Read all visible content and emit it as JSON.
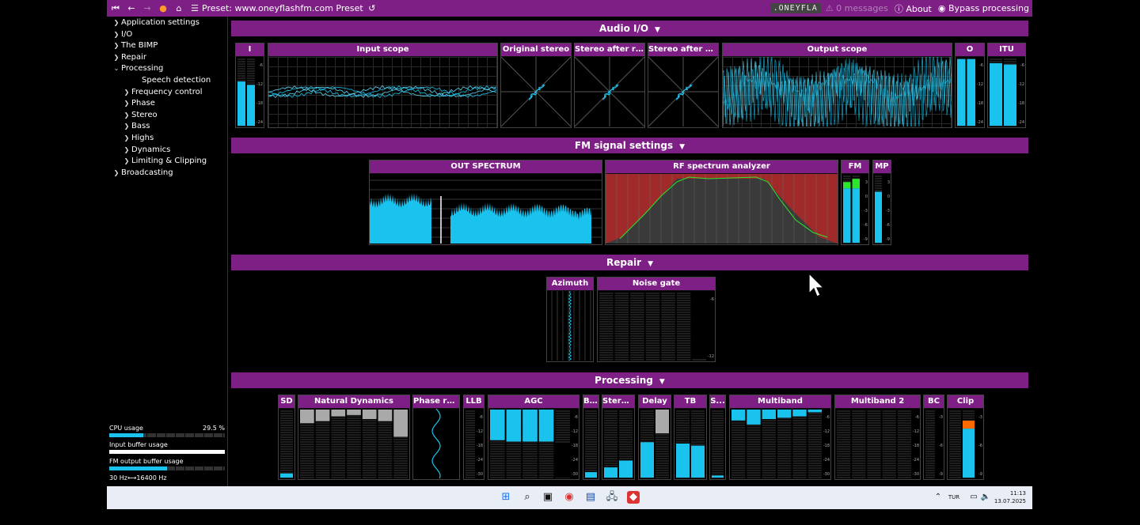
{
  "topbar": {
    "preset_label": "Preset: www.oneyflashfm.com Preset",
    "brand": ".ONEYFLA",
    "messages": "0 messages",
    "about": "About",
    "bypass": "Bypass processing"
  },
  "sidebar": {
    "items": [
      {
        "label": "Application settings",
        "indent": 0,
        "chevron": "right"
      },
      {
        "label": "I/O",
        "indent": 0,
        "chevron": "right"
      },
      {
        "label": "The BIMP",
        "indent": 0,
        "chevron": "right"
      },
      {
        "label": "Repair",
        "indent": 0,
        "chevron": "right"
      },
      {
        "label": "Processing",
        "indent": 0,
        "chevron": "down"
      },
      {
        "label": "Speech detection",
        "indent": 2,
        "chevron": "none"
      },
      {
        "label": "Frequency control",
        "indent": 1,
        "chevron": "right"
      },
      {
        "label": "Phase",
        "indent": 1,
        "chevron": "right"
      },
      {
        "label": "Stereo",
        "indent": 1,
        "chevron": "right"
      },
      {
        "label": "Bass",
        "indent": 1,
        "chevron": "right"
      },
      {
        "label": "Highs",
        "indent": 1,
        "chevron": "right"
      },
      {
        "label": "Dynamics",
        "indent": 1,
        "chevron": "right"
      },
      {
        "label": "Limiting & Clipping",
        "indent": 1,
        "chevron": "right"
      },
      {
        "label": "Broadcasting",
        "indent": 0,
        "chevron": "right"
      }
    ],
    "cpu_label": "CPU usage",
    "cpu_value": "29.5 %",
    "cpu_fraction": 0.295,
    "input_buffer_label": "Input buffer usage",
    "input_buffer_fraction": 1.0,
    "fm_buffer_label": "FM output buffer usage",
    "fm_buffer_fraction": 0.5,
    "freq_low": "30 Hz",
    "freq_high": "16400 Hz"
  },
  "sections": {
    "audio_io": "Audio I/O",
    "fm_signal": "FM signal settings",
    "repair": "Repair",
    "processing": "Processing"
  },
  "panels": {
    "input_meter": "I",
    "input_scope": "Input scope",
    "original_stereo": "Original stereo",
    "stereo_after_rep": "Stereo after rep...",
    "stereo_after_pro": "Stereo after pro...",
    "output_scope": "Output scope",
    "output_meter": "O",
    "itu": "ITU",
    "out_spectrum": "OUT SPECTRUM",
    "rf_analyzer": "RF spectrum analyzer",
    "fm": "FM",
    "mp": "MP",
    "azimuth": "Azimuth",
    "noise_gate": "Noise gate",
    "sd": "SD",
    "natural_dynamics": "Natural Dynamics",
    "phase_rot": "Phase rot...",
    "llb": "LLB",
    "agc": "AGC",
    "b": "B...",
    "stereo": "Stere...",
    "delay": "Delay",
    "tb": "TB",
    "s": "S...",
    "multiband": "Multiband",
    "multiband2": "Multiband 2",
    "bc": "BC",
    "clip": "Clip"
  },
  "meter_ticks": {
    "io": [
      "-6",
      "-12",
      "-18",
      "-24"
    ],
    "fm": [
      "3",
      "0",
      "-3",
      "-6",
      "-9"
    ],
    "ng": [
      "-6",
      "-12"
    ],
    "agc": [
      "-6",
      "-12",
      "-18",
      "-24",
      "-30"
    ],
    "bc": [
      "-3",
      "-6",
      "-9"
    ]
  },
  "colors": {
    "accent": "#7e1f86",
    "meter": "#19c3ee",
    "gray_bar": "#a9a9a9",
    "green": "#2ee62e",
    "orange": "#ff6a00",
    "rf_red": "#a02a2a"
  },
  "taskbar": {
    "lang": "TUR",
    "time": "11:13",
    "date": "13.07.2025"
  }
}
